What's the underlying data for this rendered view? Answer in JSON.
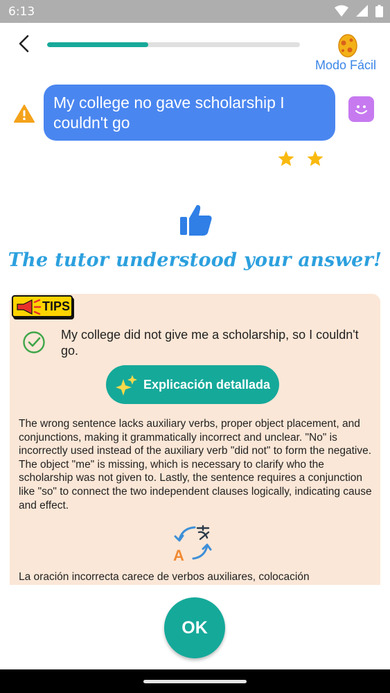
{
  "status_bar": {
    "time": "6:13"
  },
  "header": {
    "progress": 0.4,
    "mode_label": "Modo Fácil"
  },
  "chat": {
    "user_message": "My college no gave scholarship I couldn't go",
    "stars": 2
  },
  "feedback": {
    "headline": "The tutor understood your answer!"
  },
  "tips": {
    "badge": "TIPS",
    "corrected": "My college did not give me a scholarship, so I couldn't go.",
    "explain_button": "Explicación detallada",
    "explanation_en": "The wrong sentence lacks auxiliary verbs, proper object placement, and conjunctions, making it grammatically incorrect and unclear. \"No\" is incorrectly used instead of the auxiliary verb \"did not\" to form the negative. The object \"me\" is missing, which is necessary to clarify who the scholarship was not given to. Lastly, the sentence requires a conjunction like \"so\" to connect the two independent clauses logically, indicating cause and effect.",
    "explanation_es": "La oración incorrecta carece de verbos auxiliares, colocación"
  },
  "footer": {
    "ok_label": "OK"
  },
  "colors": {
    "accent": "#15a99a",
    "bubble": "#4a86f0",
    "mode_text": "#3b86e6",
    "headline": "#2ca0de",
    "card_bg": "#fbe7d7",
    "warning": "#f4a21a",
    "star": "#f9b90f"
  }
}
